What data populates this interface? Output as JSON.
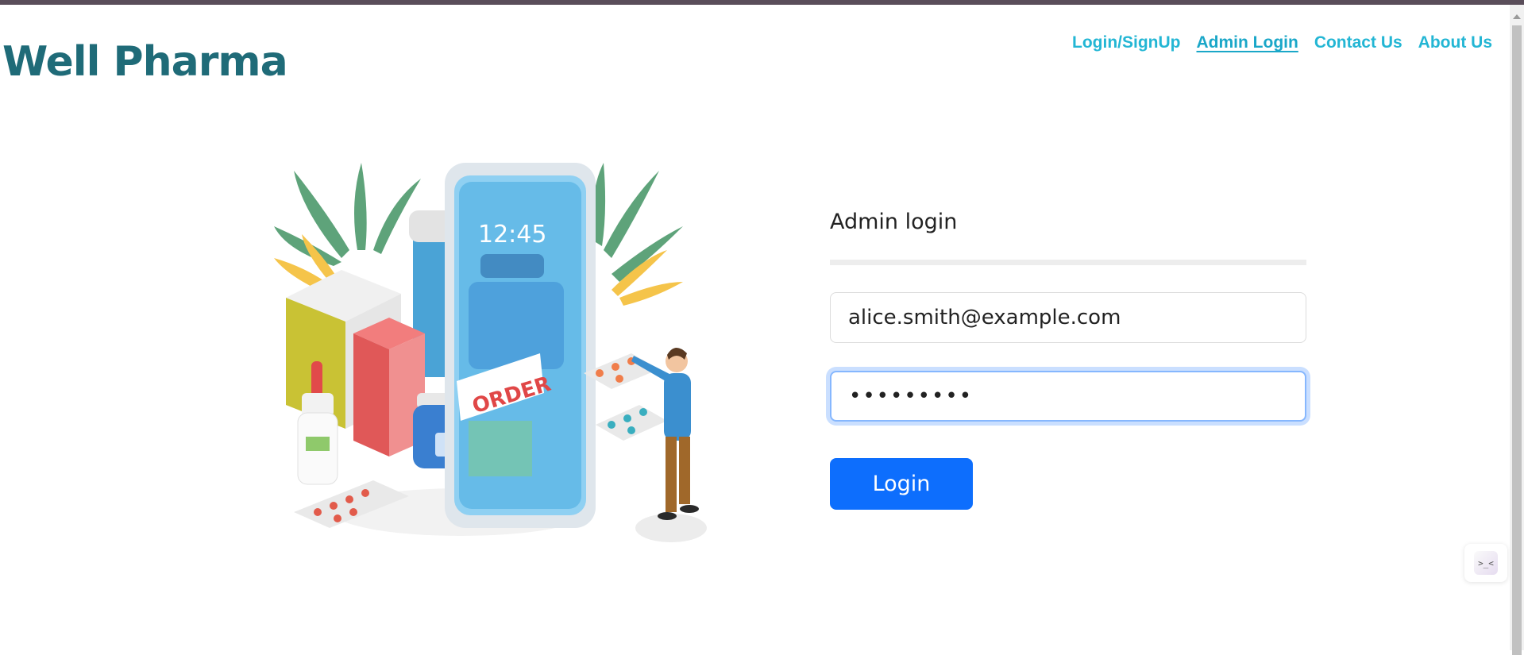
{
  "brand": {
    "name": "Well Pharma"
  },
  "nav": {
    "items": [
      {
        "label": "Login/SignUp"
      },
      {
        "label": "Admin Login"
      },
      {
        "label": "Contact Us"
      },
      {
        "label": "About Us"
      }
    ],
    "active": "Admin Login"
  },
  "illustration": {
    "phone_time": "12:45",
    "order_label": "ORDER"
  },
  "form": {
    "title": "Admin login",
    "email_value": "alice.smith@example.com",
    "password_value": "•••••••••",
    "login_label": "Login"
  },
  "widget": {
    "icon_text": ">_<"
  },
  "colors": {
    "brand": "#1f6b78",
    "nav_link": "#23b6d4",
    "primary_button": "#0d6efd",
    "focus_ring": "#86b7fe"
  }
}
